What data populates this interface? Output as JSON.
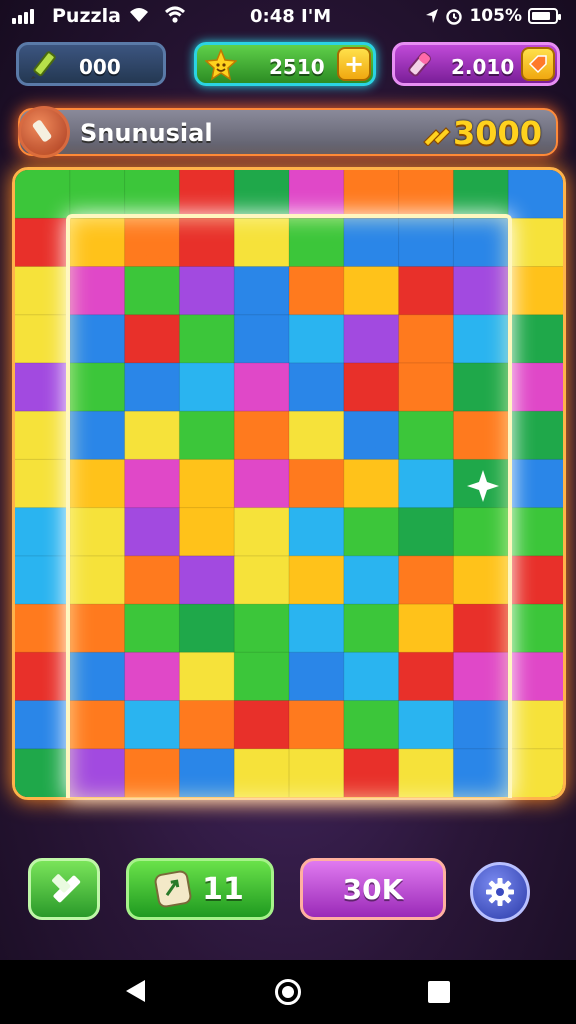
{
  "status_bar": {
    "carrier": "Puzzla",
    "time": "0:48 I'M",
    "battery": "105%"
  },
  "currencies": [
    {
      "icon": "pencil-icon",
      "value": "000"
    },
    {
      "icon": "smiley-star-icon",
      "value": "2510",
      "action": "+"
    },
    {
      "icon": "eraser-icon",
      "value": "2.010"
    }
  ],
  "level_banner": {
    "name": "Snunusial",
    "score": "3000",
    "score_color": "#ffd21e"
  },
  "board": {
    "rows": 13,
    "cols": 10,
    "palette": [
      "#e8302a",
      "#ff7a1e",
      "#ffc21a",
      "#f6e23a",
      "#3cc63a",
      "#1fa84a",
      "#2ab4f0",
      "#2a86e8",
      "#a24ae0",
      "#e048c8"
    ]
  },
  "controls": {
    "hammer_icon": "hammer-icon",
    "hints_count": "11",
    "coins_label": "30K",
    "settings_icon": "gear-icon"
  },
  "nav_bar": {
    "back_icon": "back-icon",
    "home_icon": "home-icon",
    "recents_icon": "recents-icon"
  }
}
